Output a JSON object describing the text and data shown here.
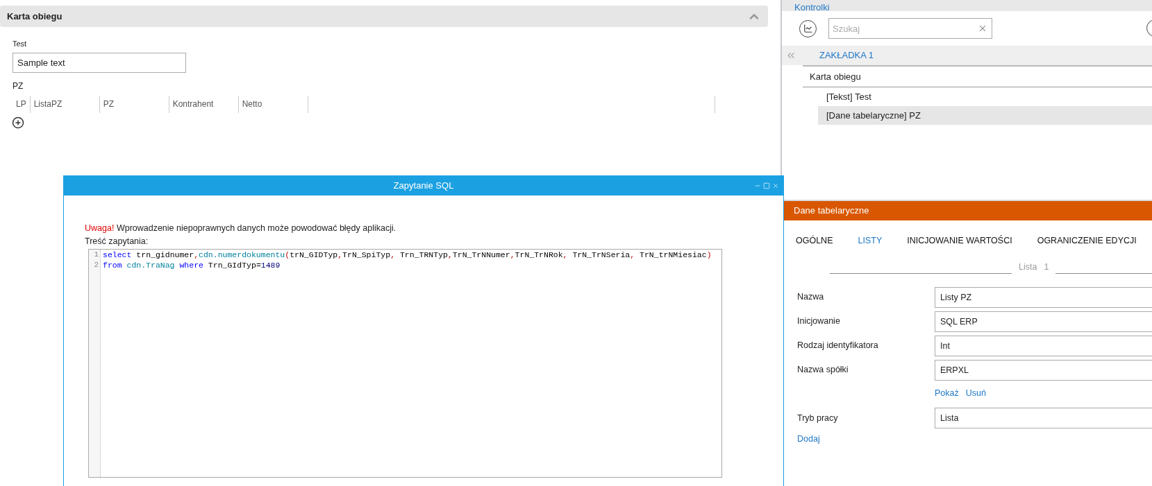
{
  "section": {
    "title": "Karta obiegu",
    "expanded": true
  },
  "text_field": {
    "label": "Test",
    "value": "Sample text"
  },
  "grid": {
    "label": "PZ",
    "columns": [
      "LP",
      "ListaPZ",
      "PZ",
      "Kontrahent",
      "Netto"
    ]
  },
  "sql_dialog": {
    "title": "Zapytanie SQL",
    "warning_prefix": "Uwaga!",
    "warning": "Wprowadzenie niepoprawnych danych może powodować błędy aplikacji.",
    "query_label": "Treść zapytania:",
    "lines": [
      {
        "number": "1",
        "tokens": [
          {
            "kind": "keyword",
            "text": "select"
          },
          {
            "kind": "plain",
            "text": " trn_gidnumer"
          },
          {
            "kind": "op",
            "text": ","
          },
          {
            "kind": "function",
            "text": "cdn.numerdokumentu"
          },
          {
            "kind": "op",
            "text": "("
          },
          {
            "kind": "plain",
            "text": "trN_GIDTyp"
          },
          {
            "kind": "op",
            "text": ","
          },
          {
            "kind": "plain",
            "text": "TrN_SpiTyp"
          },
          {
            "kind": "op",
            "text": ","
          },
          {
            "kind": "plain",
            "text": " Trn_TRNTyp"
          },
          {
            "kind": "op",
            "text": ","
          },
          {
            "kind": "plain",
            "text": "TrN_TrNNumer"
          },
          {
            "kind": "op",
            "text": ","
          },
          {
            "kind": "plain",
            "text": "TrN_TrNRok"
          },
          {
            "kind": "op",
            "text": ","
          },
          {
            "kind": "plain",
            "text": " TrN_TrNSeria"
          },
          {
            "kind": "op",
            "text": ","
          },
          {
            "kind": "plain",
            "text": " TrN_trNMiesiac"
          },
          {
            "kind": "op",
            "text": ")"
          }
        ]
      },
      {
        "number": "2",
        "tokens": [
          {
            "kind": "keyword",
            "text": "from"
          },
          {
            "kind": "function",
            "text": " cdn.TraNag"
          },
          {
            "kind": "keyword",
            "text": " where"
          },
          {
            "kind": "plain",
            "text": " Trn_GIdTyp"
          },
          {
            "kind": "plain",
            "text": "="
          },
          {
            "kind": "number",
            "text": "1489"
          }
        ]
      }
    ]
  },
  "controls_panel": {
    "title": "Kontrolki",
    "search": {
      "placeholder": "Szukaj"
    },
    "tab": "ZAKŁADKA 1",
    "tree": [
      {
        "label": "Karta obiegu",
        "selected": false,
        "children": [
          {
            "label": "[Tekst] Test",
            "selected": false
          },
          {
            "label": "[Dane tabelaryczne] PZ",
            "selected": true
          }
        ]
      }
    ]
  },
  "properties": {
    "title": "Dane tabelaryczne",
    "tabs": [
      {
        "label": "OGÓLNE",
        "selected": false
      },
      {
        "label": "LISTY",
        "selected": true
      },
      {
        "label": "INICJOWANIE WARTOŚCI",
        "selected": false
      },
      {
        "label": "OGRANICZENIE EDYCJI",
        "selected": false
      }
    ],
    "list_caption": "Lista",
    "list_number": "1",
    "fields": [
      {
        "label": "Nazwa",
        "value": "Listy PZ"
      },
      {
        "label": "Inicjowanie",
        "value": "SQL ERP"
      },
      {
        "label": "Rodzaj identyfikatora",
        "value": "Int"
      },
      {
        "label": "Nazwa spółki",
        "value": "ERPXL"
      }
    ],
    "links": [
      "Pokaż",
      "Usuń"
    ],
    "mode_field": {
      "label": "Tryb pracy",
      "value": "Lista"
    },
    "add_link": "Dodaj"
  }
}
